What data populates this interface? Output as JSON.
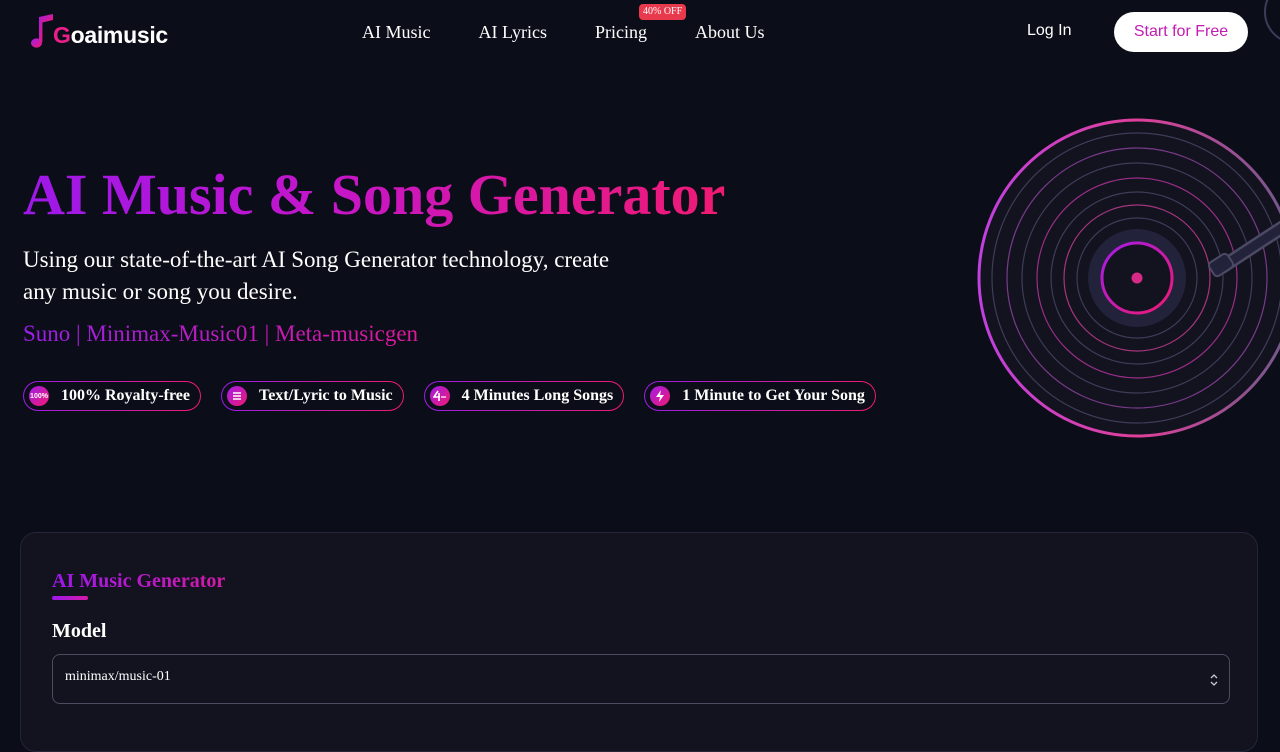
{
  "brand": {
    "prefix": "G",
    "name": "oaimusic",
    "accent": "#ec1f8a"
  },
  "nav": {
    "items": [
      {
        "label": "AI Music"
      },
      {
        "label": "AI Lyrics"
      },
      {
        "label": "Pricing"
      },
      {
        "label": "About Us"
      }
    ],
    "pricing_badge": "40% OFF",
    "login": "Log In",
    "cta": "Start for Free"
  },
  "hero": {
    "title": "AI Music & Song Generator",
    "subtitle": "Using our state-of-the-art AI Song Generator technology, create any music or song you desire.",
    "models": "Suno | Minimax-Music01 | Meta-musicgen",
    "features": [
      {
        "icon": "royalty-free-badge-icon",
        "icon_text": "100%",
        "label": "100% Royalty-free"
      },
      {
        "icon": "lyrics-list-icon",
        "label": "Text/Lyric to Music"
      },
      {
        "icon": "four-minutes-icon",
        "label": "4 Minutes Long Songs"
      },
      {
        "icon": "lightning-icon",
        "label": "1 Minute to Get Your Song"
      }
    ],
    "gradient": [
      "#9d18ea",
      "#c616c8",
      "#f01a72"
    ]
  },
  "generator": {
    "tab": "AI Music Generator",
    "model_label": "Model",
    "model_value": "minimax/music-01"
  },
  "colors": {
    "background": "#0b0d18",
    "card": "#12131f",
    "badge": "#e8394d",
    "cta_text": "#c21cb2"
  }
}
